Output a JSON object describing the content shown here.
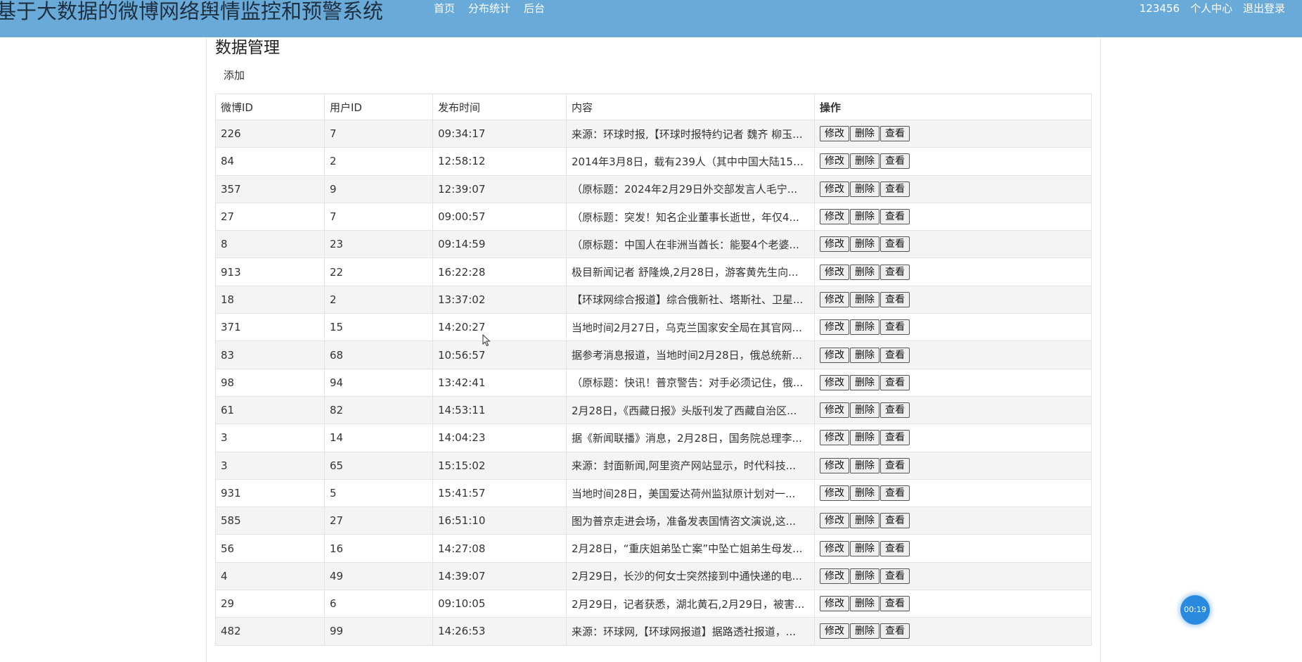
{
  "header": {
    "title": "基于大数据的微博网络舆情监控和预警系统",
    "nav": [
      "首页",
      "分布统计",
      "后台"
    ],
    "username": "123456",
    "profile_label": "个人中心",
    "logout_label": "退出登录",
    "bg_color": "#6aaad9"
  },
  "main": {
    "title": "数据管理",
    "add_label": "添加"
  },
  "table": {
    "columns": [
      "微博ID",
      "用户ID",
      "发布时间",
      "内容",
      "操作"
    ],
    "actions": [
      "修改",
      "删除",
      "查看"
    ],
    "rows": [
      {
        "weibo_id": "226",
        "user_id": "7",
        "time": "09:34:17",
        "content": "来源：环球时报,【环球时报特约记者 魏齐 柳玉..."
      },
      {
        "weibo_id": "84",
        "user_id": "2",
        "time": "12:58:12",
        "content": "2014年3月8日，载有239人（其中中国大陆153..."
      },
      {
        "weibo_id": "357",
        "user_id": "9",
        "time": "12:39:07",
        "content": "（原标题：2024年2月29日外交部发言人毛宁..."
      },
      {
        "weibo_id": "27",
        "user_id": "7",
        "time": "09:00:57",
        "content": "（原标题：突发！知名企业董事长逝世，年仅4..."
      },
      {
        "weibo_id": "8",
        "user_id": "23",
        "time": "09:14:59",
        "content": "（原标题：中国人在非洲当酋长：能娶4个老婆..."
      },
      {
        "weibo_id": "913",
        "user_id": "22",
        "time": "16:22:28",
        "content": "极目新闻记者 舒隆焕,2月28日，游客黄先生向..."
      },
      {
        "weibo_id": "18",
        "user_id": "2",
        "time": "13:37:02",
        "content": "【环球网综合报道】综合俄新社、塔斯社、卫星..."
      },
      {
        "weibo_id": "371",
        "user_id": "15",
        "time": "14:20:27",
        "content": "当地时间2月27日，乌克兰国家安全局在其官网..."
      },
      {
        "weibo_id": "83",
        "user_id": "68",
        "time": "10:56:57",
        "content": "据参考消息报道，当地时间2月28日，俄总统新..."
      },
      {
        "weibo_id": "98",
        "user_id": "94",
        "time": "13:42:41",
        "content": "（原标题：快讯！普京警告：对手必须记住，俄..."
      },
      {
        "weibo_id": "61",
        "user_id": "82",
        "time": "14:53:11",
        "content": "2月28日，《西藏日报》头版刊发了西藏自治区..."
      },
      {
        "weibo_id": "3",
        "user_id": "14",
        "time": "14:04:23",
        "content": "据《新闻联播》消息，2月28日，国务院总理李..."
      },
      {
        "weibo_id": "3",
        "user_id": "65",
        "time": "15:15:02",
        "content": "来源：封面新闻,阿里资产网站显示，时代科技..."
      },
      {
        "weibo_id": "931",
        "user_id": "5",
        "time": "15:41:57",
        "content": "当地时间28日，美国爱达荷州监狱原计划对一..."
      },
      {
        "weibo_id": "585",
        "user_id": "27",
        "time": "16:51:10",
        "content": "图为普京走进会场，准备发表国情咨文演说,这..."
      },
      {
        "weibo_id": "56",
        "user_id": "16",
        "time": "14:27:08",
        "content": "2月28日，“重庆姐弟坠亡案”中坠亡姐弟生母发..."
      },
      {
        "weibo_id": "4",
        "user_id": "49",
        "time": "14:39:07",
        "content": "2月29日，长沙的何女士突然接到中通快递的电..."
      },
      {
        "weibo_id": "29",
        "user_id": "6",
        "time": "09:10:05",
        "content": "2月29日，记者获悉，湖北黄石,2月29日，被害..."
      },
      {
        "weibo_id": "482",
        "user_id": "99",
        "time": "14:26:53",
        "content": "来源：环球网,【环球网报道】据路透社报道，..."
      }
    ]
  },
  "timer": {
    "label": "00:19",
    "color": "#2a8ae0"
  }
}
